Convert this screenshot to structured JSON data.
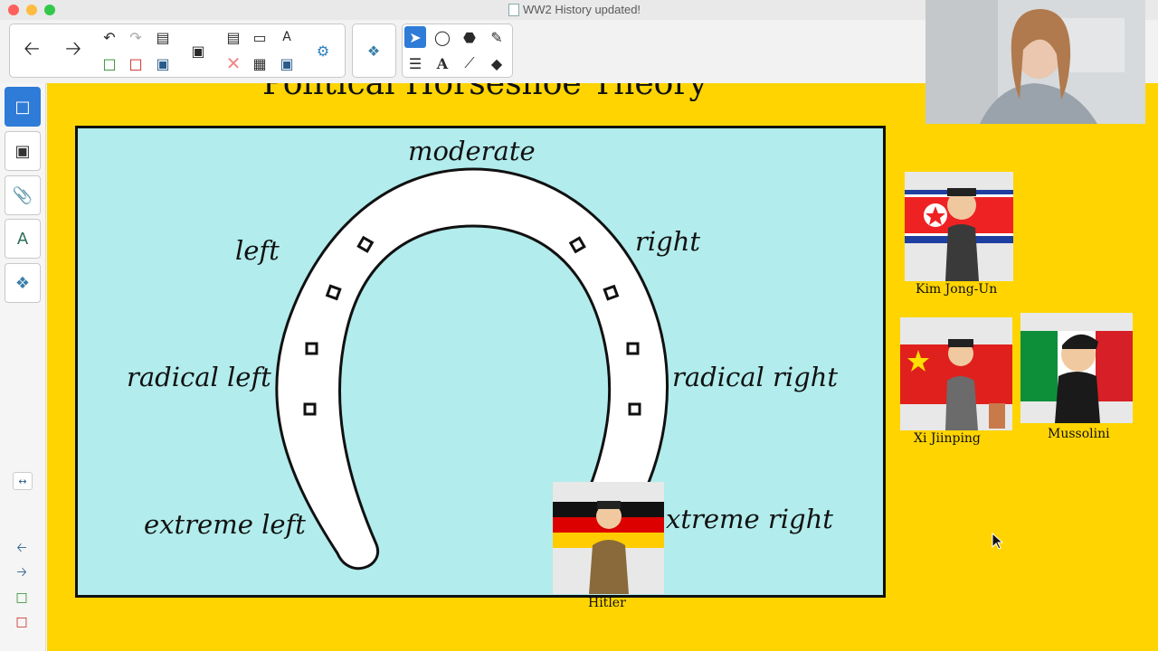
{
  "window": {
    "title": "WW2 History updated!"
  },
  "slide": {
    "title": "Political Horseshoe Theory",
    "labels": {
      "moderate": "moderate",
      "left": "left",
      "right": "right",
      "radical_left": "radical left",
      "radical_right": "radical right",
      "extreme_left": "extreme left",
      "extreme_right": "xtreme right"
    },
    "leaders": [
      {
        "name": "Kim Jong-Un",
        "flag": "North Korea"
      },
      {
        "name": "Xi Jiinping",
        "flag": "China"
      },
      {
        "name": "Mussolini",
        "flag": "Italy"
      },
      {
        "name": "Hitler",
        "flag": "Germany"
      }
    ]
  },
  "colors": {
    "canvas_bg": "#ffd400",
    "board_bg": "#b2ecec",
    "accent": "#2f7bd8"
  },
  "toolbar": {
    "icons": [
      "back-arrow-icon",
      "forward-arrow-icon",
      "undo-icon",
      "redo-icon",
      "clipboard-icon",
      "new-page-icon",
      "delete-page-icon",
      "save-icon",
      "screen-share-icon",
      "paste-icon",
      "display-icon",
      "font-tool-icon",
      "close-x-icon",
      "table-icon",
      "screen-capture-icon",
      "add-on-icon",
      "puzzle-icon",
      "select-icon",
      "shapes-icon",
      "fill-icon",
      "pen-icon",
      "measure-icon",
      "text-icon",
      "line-icon",
      "eraser-icon"
    ]
  },
  "sidebar": {
    "tabs": [
      "page-sorter-icon",
      "gallery-icon",
      "attachments-icon",
      "properties-icon",
      "add-ons-icon"
    ]
  }
}
